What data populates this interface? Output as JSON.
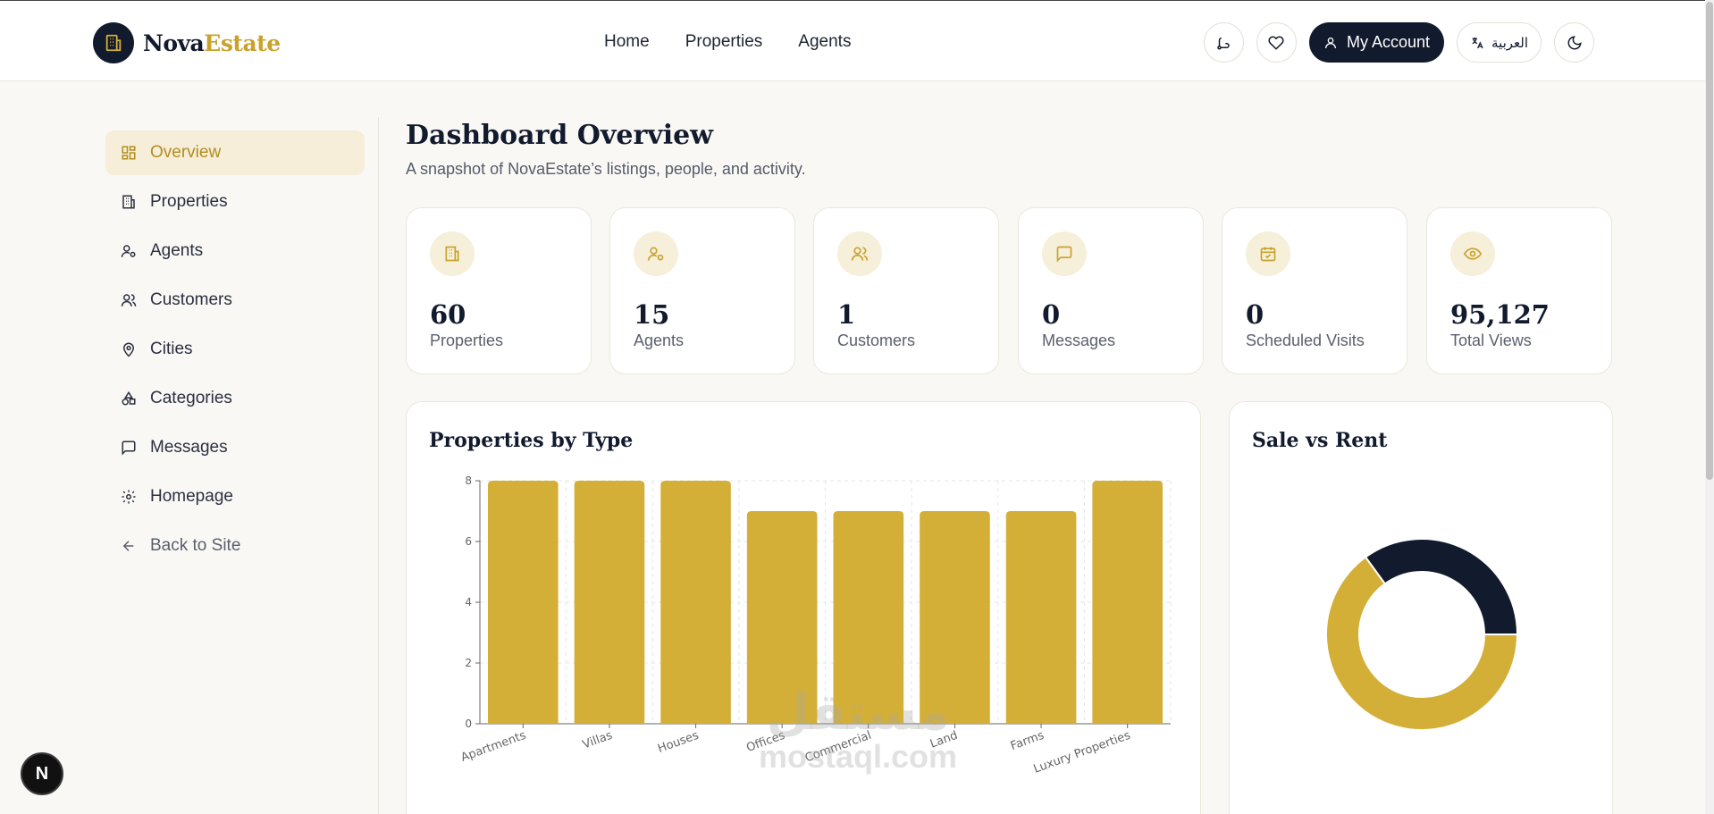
{
  "brand": {
    "name_part1": "Nova",
    "name_part2": "Estate"
  },
  "nav": {
    "items": [
      "Home",
      "Properties",
      "Agents"
    ]
  },
  "header": {
    "account_label": "My Account",
    "language_label": "العربية"
  },
  "sidebar": {
    "items": [
      {
        "label": "Overview",
        "icon": "grid-icon",
        "active": true
      },
      {
        "label": "Properties",
        "icon": "building-icon"
      },
      {
        "label": "Agents",
        "icon": "user-gear-icon"
      },
      {
        "label": "Customers",
        "icon": "users-icon"
      },
      {
        "label": "Cities",
        "icon": "map-pin-icon"
      },
      {
        "label": "Categories",
        "icon": "shapes-icon"
      },
      {
        "label": "Messages",
        "icon": "message-icon"
      },
      {
        "label": "Homepage",
        "icon": "gear-icon"
      },
      {
        "label": "Back to Site",
        "icon": "arrow-left-icon"
      }
    ]
  },
  "page": {
    "title": "Dashboard Overview",
    "subtitle": "A snapshot of NovaEstate’s listings, people, and activity."
  },
  "stats": [
    {
      "value": "60",
      "label": "Properties",
      "icon": "building-icon"
    },
    {
      "value": "15",
      "label": "Agents",
      "icon": "user-gear-icon"
    },
    {
      "value": "1",
      "label": "Customers",
      "icon": "users-icon"
    },
    {
      "value": "0",
      "label": "Messages",
      "icon": "message-icon"
    },
    {
      "value": "0",
      "label": "Scheduled Visits",
      "icon": "calendar-check-icon"
    },
    {
      "value": "95,127",
      "label": "Total Views",
      "icon": "eye-icon"
    }
  ],
  "colors": {
    "accent": "#d4af37",
    "navy": "#121a2e",
    "active_bg": "#f6eed8"
  },
  "watermark": {
    "arabic": "مستقل",
    "latin": "mostaql.com"
  },
  "badge": {
    "label": "N"
  },
  "chart_data": [
    {
      "type": "bar",
      "title": "Properties by Type",
      "categories": [
        "Apartments",
        "Villas",
        "Houses",
        "Offices",
        "Commercial",
        "Land",
        "Farms",
        "Luxury Properties"
      ],
      "values": [
        8,
        8,
        8,
        7,
        7,
        7,
        7,
        8
      ],
      "ylim": [
        0,
        8
      ],
      "yticks": [
        0,
        2,
        4,
        6,
        8
      ],
      "xlabel": "",
      "ylabel": "",
      "grid": true,
      "color": "#d4af37"
    },
    {
      "type": "pie",
      "title": "Sale vs Rent",
      "donut": true,
      "slices": [
        {
          "name": "",
          "value": 65,
          "color": "#d4af37"
        },
        {
          "name": "",
          "value": 35,
          "color": "#121a2e"
        }
      ]
    }
  ]
}
